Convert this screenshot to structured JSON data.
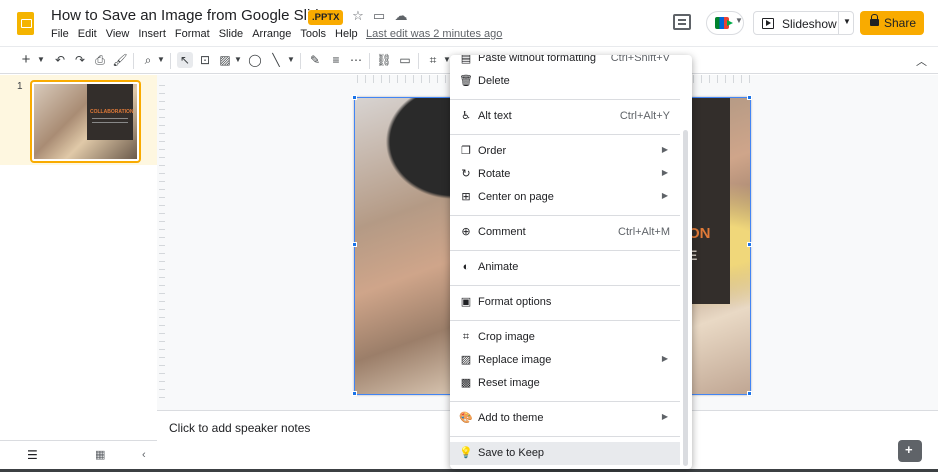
{
  "header": {
    "doc_title": "How to Save an Image from Google Slides?",
    "badge": ".PPTX",
    "last_edit": "Last edit was 2 minutes ago",
    "slideshow_label": "Slideshow",
    "share_label": "Share"
  },
  "menu": [
    "File",
    "Edit",
    "View",
    "Insert",
    "Format",
    "Slide",
    "Arrange",
    "Tools",
    "Help"
  ],
  "filmstrip": {
    "slide_number": "1",
    "thumb_title": "COLLABORATION"
  },
  "slide": {
    "title_fragment": "ON",
    "sub_fragment": "E"
  },
  "notes": {
    "placeholder": "Click to add speaker notes"
  },
  "context_menu": {
    "items": [
      {
        "label": "Paste without formatting",
        "shortcut": "Ctrl+Shift+V",
        "icon": "paste-icon"
      },
      {
        "label": "Delete",
        "shortcut": "",
        "icon": "trash-icon"
      },
      {
        "label": "Alt text",
        "shortcut": "Ctrl+Alt+Y",
        "icon": "accessibility-icon"
      },
      {
        "label": "Order",
        "shortcut": "",
        "icon": "order-icon",
        "submenu": true
      },
      {
        "label": "Rotate",
        "shortcut": "",
        "icon": "rotate-icon",
        "submenu": true
      },
      {
        "label": "Center on page",
        "shortcut": "",
        "icon": "center-icon",
        "submenu": true
      },
      {
        "label": "Comment",
        "shortcut": "Ctrl+Alt+M",
        "icon": "comment-add-icon"
      },
      {
        "label": "Animate",
        "shortcut": "",
        "icon": "animate-icon"
      },
      {
        "label": "Format options",
        "shortcut": "",
        "icon": "format-options-icon"
      },
      {
        "label": "Crop image",
        "shortcut": "",
        "icon": "crop-icon"
      },
      {
        "label": "Replace image",
        "shortcut": "",
        "icon": "replace-image-icon",
        "submenu": true
      },
      {
        "label": "Reset image",
        "shortcut": "",
        "icon": "reset-image-icon"
      },
      {
        "label": "Add to theme",
        "shortcut": "",
        "icon": "palette-icon",
        "submenu": true
      },
      {
        "label": "Save to Keep",
        "shortcut": "",
        "icon": "keep-icon"
      }
    ]
  },
  "colors": {
    "accent": "#f9ab00",
    "selection": "#1a73e8",
    "slide_accent": "#e07a38"
  }
}
